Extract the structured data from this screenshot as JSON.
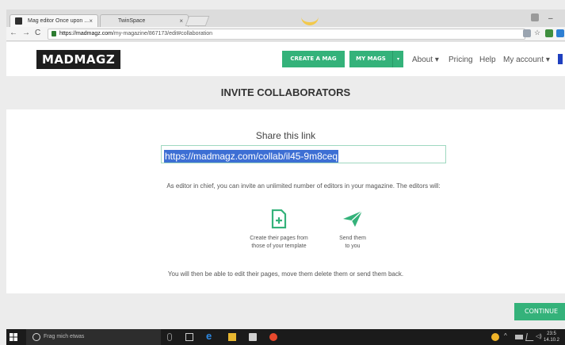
{
  "browser": {
    "tabs": [
      {
        "title": "Mag editor Once upon ...",
        "close": "×"
      },
      {
        "title": "TwinSpace",
        "close": "×"
      }
    ],
    "nav": {
      "back": "←",
      "forward": "→",
      "reload": "C"
    },
    "url": {
      "host": "https://madmagz.com",
      "path": "/my-magazine/867173/edit#collaboration"
    },
    "window_controls": {
      "minimize": "–"
    }
  },
  "site_nav": {
    "logo": "MADMAGZ",
    "create_button": "CREATE A MAG",
    "mymags_button": "MY MAGS",
    "mymags_caret": "▾",
    "about": "About ▾",
    "pricing": "Pricing",
    "help": "Help",
    "account": "My account ▾"
  },
  "main": {
    "title": "INVITE COLLABORATORS",
    "share_label": "Share this link",
    "share_link": "https://madmagz.com/collab/il45-9m8ceq",
    "invite_text": "As editor in chief, you can invite an unlimited number of editors in your magazine. The editors will:",
    "features": [
      {
        "icon": "new-page-icon",
        "line1": "Create their pages from",
        "line2": "those of your template"
      },
      {
        "icon": "paper-plane-icon",
        "line1": "Send them",
        "line2": "to you"
      }
    ],
    "bottom_text": "You will then be able to edit their pages, move them delete them or send them back.",
    "continue_button": "CONTINUE"
  },
  "taskbar": {
    "search_placeholder": "Frag mich etwas",
    "time": "23:5",
    "date": "14.10.2"
  },
  "colors": {
    "accent_green": "#34b27a",
    "selection_blue": "#3d6fd4",
    "logo_bg": "#1e1e1e"
  }
}
